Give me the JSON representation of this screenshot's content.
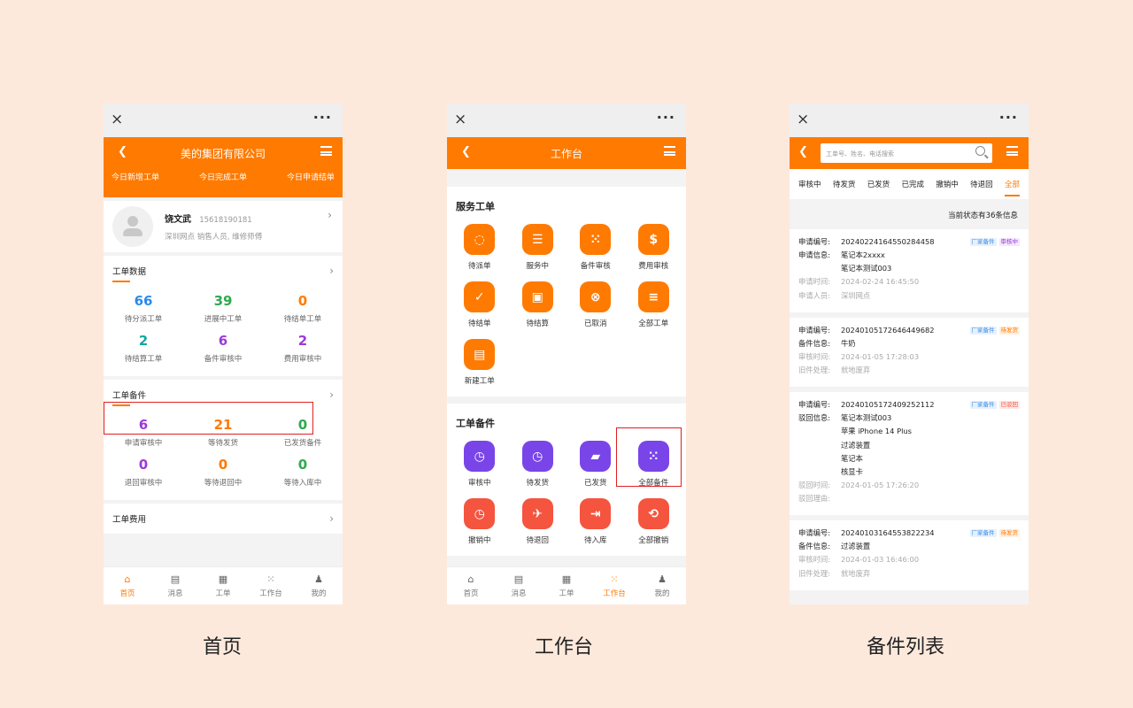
{
  "colors": {
    "accent": "#ff7a00",
    "background": "#fde9dc",
    "blue": "#2a8be8",
    "green": "#2fa84f",
    "purple": "#9b3ad8",
    "teal": "#13a89e"
  },
  "window": {
    "close": "×",
    "more": "···"
  },
  "home": {
    "caption": "首页",
    "company": "美的集团有限公司",
    "subnav": [
      "今日新增工单",
      "今日完成工单",
      "今日申请结单"
    ],
    "user": {
      "name": "饶文武",
      "phone": "15618190181",
      "desc": "深圳网点  销售人员, 维修师傅"
    },
    "order_data": {
      "title": "工单数据",
      "stats": [
        {
          "value": "66",
          "label": "待分派工单",
          "color": "#2a8be8"
        },
        {
          "value": "39",
          "label": "进展中工单",
          "color": "#2fa84f"
        },
        {
          "value": "0",
          "label": "待结单工单",
          "color": "#ff7a00"
        },
        {
          "value": "2",
          "label": "待结算工单",
          "color": "#13a89e"
        },
        {
          "value": "6",
          "label": "备件审核中",
          "color": "#9b3ad8"
        },
        {
          "value": "2",
          "label": "费用审核中",
          "color": "#9b3ad8"
        }
      ]
    },
    "parts": {
      "title": "工单备件",
      "stats": [
        {
          "value": "6",
          "label": "申请审核中",
          "color": "#9b3ad8"
        },
        {
          "value": "21",
          "label": "等待发货",
          "color": "#ff7a00"
        },
        {
          "value": "0",
          "label": "已发货备件",
          "color": "#2fa84f"
        },
        {
          "value": "0",
          "label": "退回审核中",
          "color": "#9b3ad8"
        },
        {
          "value": "0",
          "label": "等待退回中",
          "color": "#ff7a00"
        },
        {
          "value": "0",
          "label": "等待入库中",
          "color": "#2fa84f"
        }
      ]
    },
    "fees": {
      "title": "工单费用"
    }
  },
  "tabbar": [
    {
      "icon": "home-icon",
      "glyph": "⌂",
      "label": "首页"
    },
    {
      "icon": "message-icon",
      "glyph": "▤",
      "label": "消息"
    },
    {
      "icon": "document-icon",
      "glyph": "▦",
      "label": "工单"
    },
    {
      "icon": "workbench-icon",
      "glyph": "⁙",
      "label": "工作台"
    },
    {
      "icon": "user-icon",
      "glyph": "♟",
      "label": "我的"
    }
  ],
  "workbench": {
    "caption": "工作台",
    "title": "工作台",
    "service": {
      "title": "服务工单",
      "items": [
        {
          "label": "待派单",
          "glyph": "◌",
          "icon": "refresh-icon"
        },
        {
          "label": "服务中",
          "glyph": "☰",
          "icon": "list-icon"
        },
        {
          "label": "备件审核",
          "glyph": "⁙",
          "icon": "grid-icon"
        },
        {
          "label": "费用审核",
          "glyph": "$",
          "icon": "money-icon"
        },
        {
          "label": "待结单",
          "glyph": "✓",
          "icon": "shield-check-icon"
        },
        {
          "label": "待结算",
          "glyph": "▣",
          "icon": "wallet-icon"
        },
        {
          "label": "已取消",
          "glyph": "⊗",
          "icon": "cancel-icon"
        },
        {
          "label": "全部工单",
          "glyph": "≡",
          "icon": "menu-icon"
        },
        {
          "label": "新建工单",
          "glyph": "▤",
          "icon": "new-document-icon"
        }
      ]
    },
    "parts": {
      "title": "工单备件",
      "items": [
        {
          "label": "审核中",
          "glyph": "◷",
          "icon": "clock-icon",
          "tone": "pi"
        },
        {
          "label": "待发货",
          "glyph": "◷",
          "icon": "clock-icon",
          "tone": "pi"
        },
        {
          "label": "已发货",
          "glyph": "▰",
          "icon": "truck-icon",
          "tone": "pi"
        },
        {
          "label": "全部备件",
          "glyph": "⁙",
          "icon": "grid-icon",
          "tone": "pi"
        },
        {
          "label": "撤销中",
          "glyph": "◷",
          "icon": "clock-icon",
          "tone": "ri"
        },
        {
          "label": "待退回",
          "glyph": "✈",
          "icon": "plane-icon",
          "tone": "ri"
        },
        {
          "label": "待入库",
          "glyph": "⇥",
          "icon": "inbound-icon",
          "tone": "ri"
        },
        {
          "label": "全部撤销",
          "glyph": "⟲",
          "icon": "reply-all-icon",
          "tone": "ri"
        }
      ]
    }
  },
  "parts_list": {
    "caption": "备件列表",
    "search_placeholder": "工单号、姓名、电话搜索",
    "tabs": [
      "审核中",
      "待发货",
      "已发货",
      "已完成",
      "撤销中",
      "待退回",
      "全部"
    ],
    "count_text": "当前状态有36条信息",
    "records": [
      {
        "rows": [
          {
            "k": "申请编号:",
            "v": [
              "20240224164550284458"
            ],
            "muted": false
          },
          {
            "k": "申请信息:",
            "v": [
              "笔记本2xxxx",
              "笔记本测试003"
            ],
            "muted": false
          },
          {
            "k": "申请时间:",
            "v": [
              "2024-02-24 16:45:50"
            ],
            "muted": true
          },
          {
            "k": "申请人员:",
            "v": [
              "深圳网点"
            ],
            "muted": true
          }
        ],
        "tags": [
          {
            "text": "厂家备件",
            "tone": "blue"
          },
          {
            "text": "审核中",
            "tone": "purple"
          }
        ]
      },
      {
        "rows": [
          {
            "k": "申请编号:",
            "v": [
              "20240105172646449682"
            ],
            "muted": false
          },
          {
            "k": "备件信息:",
            "v": [
              "牛奶"
            ],
            "muted": false
          },
          {
            "k": "审核时间:",
            "v": [
              "2024-01-05 17:28:03"
            ],
            "muted": true
          },
          {
            "k": "旧件处理:",
            "v": [
              "就地废弃"
            ],
            "muted": true
          }
        ],
        "tags": [
          {
            "text": "厂家备件",
            "tone": "blue"
          },
          {
            "text": "待发货",
            "tone": "orange"
          }
        ]
      },
      {
        "rows": [
          {
            "k": "申请编号:",
            "v": [
              "20240105172409252112"
            ],
            "muted": false
          },
          {
            "k": "驳回信息:",
            "v": [
              "笔记本测试003",
              "苹果 iPhone 14 Plus",
              "过滤装置",
              "笔记本",
              "核显卡"
            ],
            "muted": false
          },
          {
            "k": "驳回时间:",
            "v": [
              "2024-01-05 17:26:20"
            ],
            "muted": true
          },
          {
            "k": "驳回理由:",
            "v": [
              ""
            ],
            "muted": true
          }
        ],
        "tags": [
          {
            "text": "厂家备件",
            "tone": "blue"
          },
          {
            "text": "已驳回",
            "tone": "red"
          }
        ]
      },
      {
        "rows": [
          {
            "k": "申请编号:",
            "v": [
              "20240103164553822234"
            ],
            "muted": false
          },
          {
            "k": "备件信息:",
            "v": [
              "过滤装置"
            ],
            "muted": false
          },
          {
            "k": "审核时间:",
            "v": [
              "2024-01-03 16:46:00"
            ],
            "muted": true
          },
          {
            "k": "旧件处理:",
            "v": [
              "就地废弃"
            ],
            "muted": true
          }
        ],
        "tags": [
          {
            "text": "厂家备件",
            "tone": "blue"
          },
          {
            "text": "待发货",
            "tone": "orange"
          }
        ]
      }
    ]
  }
}
